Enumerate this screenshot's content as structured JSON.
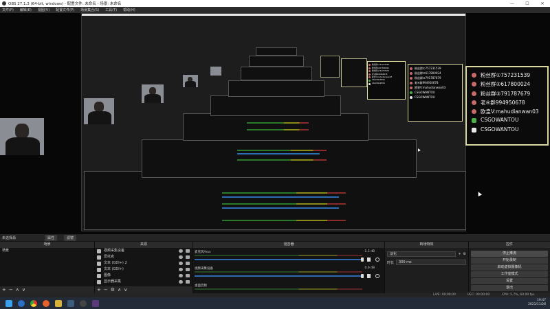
{
  "window": {
    "title": "OBS 27.1.3 (64-bit, windows) - 配置文件: 未命名 - 场景: 未命名"
  },
  "menu": [
    "文件(F)",
    "编辑(E)",
    "视图(V)",
    "配置文件(P)",
    "场景集合(S)",
    "工具(T)",
    "帮助(H)"
  ],
  "fan_box": {
    "lines": [
      "粉丝群①757231539",
      "粉丝群②617800024",
      "粉丝群③791787679",
      "老④群994950678",
      "欧皇V:mahudianwan03",
      "CSGOWANTOU",
      "CSGOWANTOU"
    ],
    "icons": [
      "penguin-icon",
      "penguin-icon",
      "penguin-icon",
      "penguin-icon",
      "penguin-icon",
      "wechat-icon",
      "tiktok-icon"
    ]
  },
  "header": {
    "selection": "未选择源",
    "props_label": "属性",
    "filters_label": "滤镜"
  },
  "docks": {
    "scenes": "场景",
    "sources": "来源",
    "mixer": "混音器",
    "transitions": "转场特效",
    "controls": "控件"
  },
  "scenes": [
    "场景"
  ],
  "sources": [
    "视频采集设备",
    "爱托克",
    "文本 (GDI+) 2",
    "文本 (GDI+)",
    "图像",
    "显示器采集"
  ],
  "mixer": [
    {
      "name": "麦克风/Aux",
      "db": "-1.3 dB",
      "level": 0.62
    },
    {
      "name": "视频采集设备",
      "db": "0.0 dB",
      "level": 0.55
    },
    {
      "name": "桌面音频",
      "db": "0.0 dB",
      "level": 0.7
    }
  ],
  "transitions": {
    "type": "淡化",
    "duration_label": "时长",
    "duration": "300 ms"
  },
  "controls": [
    "停止推流",
    "开始录制",
    "启动虚拟摄像机",
    "工作室模式",
    "设置",
    "退出"
  ],
  "status": {
    "live": "LIVE: 00:00:00",
    "rec": "REC: 00:00:00",
    "cpu": "CPU: 5.7%, 60.00 fps"
  },
  "tray": {
    "time": "19:47",
    "date": "2021/11/28"
  }
}
